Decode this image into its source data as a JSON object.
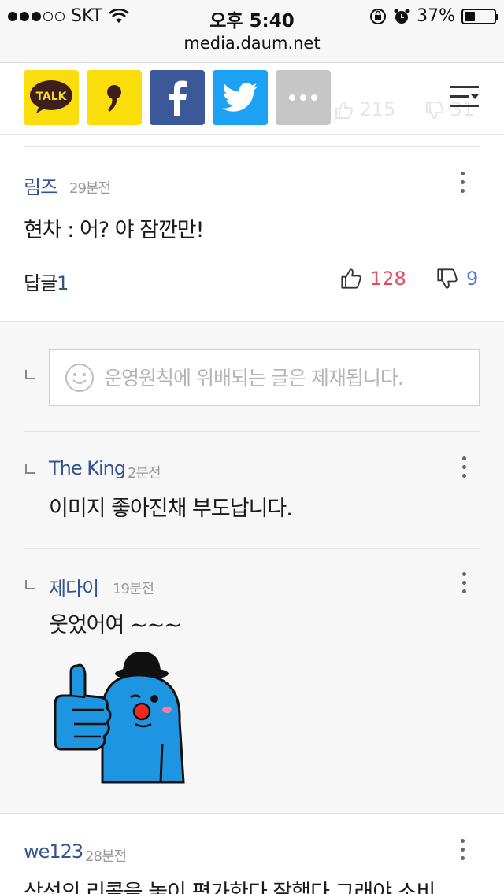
{
  "status_bar": {
    "carrier": "SKT",
    "time": "오후 5:40",
    "battery": "37%",
    "battery_level": 0.37
  },
  "url_bar": {
    "url": "media.daum.net"
  },
  "share_bar": {
    "buttons": [
      "kakaotalk",
      "kakaostory",
      "facebook",
      "twitter",
      "more"
    ],
    "talk_label": "TALK",
    "story_label": "❜",
    "fb_label": "f",
    "more_label": "•••",
    "ghost_like": "215",
    "ghost_dislike": "31"
  },
  "comments": [
    {
      "author": "림즈",
      "time": "29분전",
      "text": "현차 : 어? 야 잠깐만!",
      "reply_label": "답글",
      "reply_count": "1",
      "likes": "128",
      "dislikes": "9"
    }
  ],
  "reply_input": {
    "placeholder": "운영원칙에 위배되는 글은 제재됩니다."
  },
  "replies": [
    {
      "author": "The King",
      "time": "2분전",
      "text": "이미지 좋아진채 부도납니다."
    },
    {
      "author": "제다이",
      "time": "19분전",
      "text": "웃었어여 ~~~",
      "sticker": "blue-bowler-hat-thumbs-up-sticker"
    }
  ],
  "next_comment": {
    "author": "we123",
    "time": "28분전",
    "text": "삼성의 리콜을 놓이 평가한다 잘했다 그래야 소비"
  },
  "colors": {
    "author": "#34538f",
    "like": "#e8475d",
    "dislike": "#4b7bd6",
    "kakao_yellow": "#f9de0c",
    "facebook": "#3b5998",
    "twitter": "#1da1f2"
  }
}
